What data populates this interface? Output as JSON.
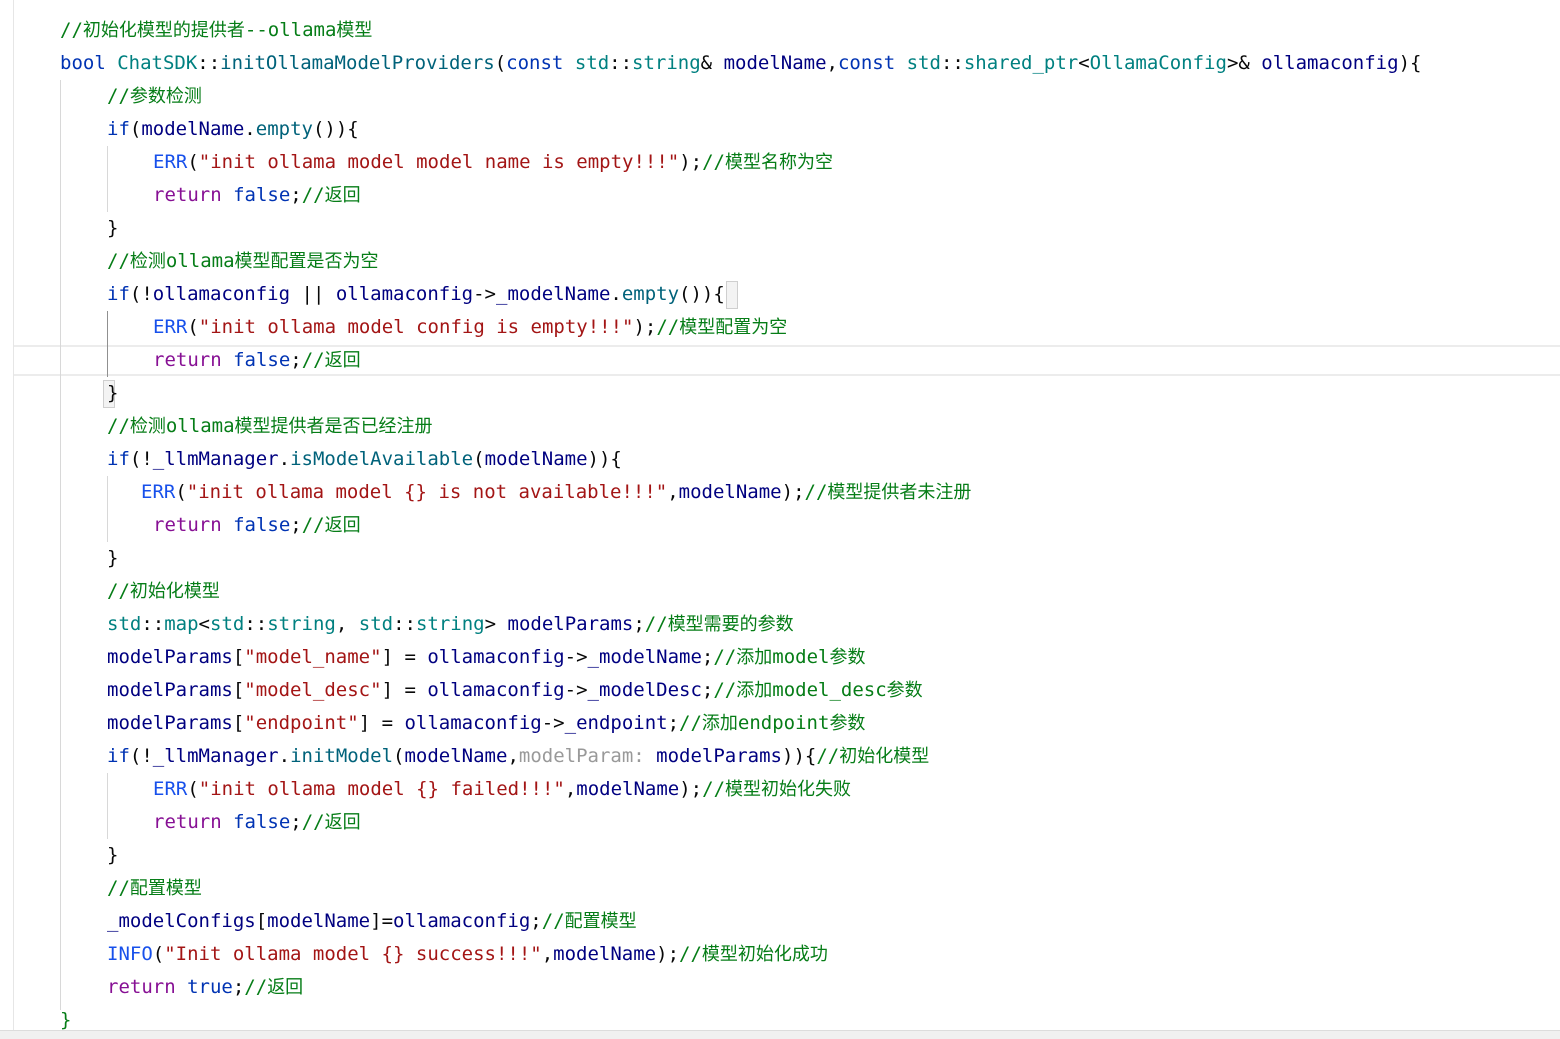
{
  "editor": {
    "lines": [
      {
        "indent": 0,
        "tokens": [
          {
            "t": "//初始化模型的提供者--ollama模型",
            "c": "c-cm-g"
          }
        ]
      },
      {
        "indent": 0,
        "tokens": [
          {
            "t": "bool ",
            "c": "c-kw"
          },
          {
            "t": "ChatSDK",
            "c": "c-ty"
          },
          {
            "t": "::",
            "c": "c-pl"
          },
          {
            "t": "initOllamaModelProviders",
            "c": "c-fn"
          },
          {
            "t": "(",
            "c": "c-pl"
          },
          {
            "t": "const ",
            "c": "c-kw"
          },
          {
            "t": "std",
            "c": "c-ty"
          },
          {
            "t": "::",
            "c": "c-pl"
          },
          {
            "t": "string",
            "c": "c-ty"
          },
          {
            "t": "& ",
            "c": "c-pl"
          },
          {
            "t": "modelName",
            "c": "c-id"
          },
          {
            "t": ",",
            "c": "c-pl"
          },
          {
            "t": "const ",
            "c": "c-kw"
          },
          {
            "t": "std",
            "c": "c-ty"
          },
          {
            "t": "::",
            "c": "c-pl"
          },
          {
            "t": "shared_ptr",
            "c": "c-ty"
          },
          {
            "t": "<",
            "c": "c-pl"
          },
          {
            "t": "OllamaConfig",
            "c": "c-ty"
          },
          {
            "t": ">& ",
            "c": "c-pl"
          },
          {
            "t": "ollamaconfig",
            "c": "c-id"
          },
          {
            "t": "){",
            "c": "c-pl"
          }
        ]
      },
      {
        "indent": 1,
        "tokens": [
          {
            "t": "//参数检测",
            "c": "c-cm-g"
          }
        ]
      },
      {
        "indent": 1,
        "tokens": [
          {
            "t": "if",
            "c": "c-kw"
          },
          {
            "t": "(",
            "c": "c-pl"
          },
          {
            "t": "modelName",
            "c": "c-id"
          },
          {
            "t": ".",
            "c": "c-pl"
          },
          {
            "t": "empty",
            "c": "c-fn"
          },
          {
            "t": "()){",
            "c": "c-pl"
          }
        ]
      },
      {
        "indent": 2,
        "tokens": [
          {
            "t": "ERR",
            "c": "c-mac"
          },
          {
            "t": "(",
            "c": "c-pl"
          },
          {
            "t": "\"init ollama model model name is empty!!!\"",
            "c": "c-str"
          },
          {
            "t": ");",
            "c": "c-pl"
          },
          {
            "t": "//模型名称为空",
            "c": "c-cm-g"
          }
        ]
      },
      {
        "indent": 2,
        "tokens": [
          {
            "t": "return ",
            "c": "c-kw2"
          },
          {
            "t": "false",
            "c": "c-kw"
          },
          {
            "t": ";",
            "c": "c-pl"
          },
          {
            "t": "//返回",
            "c": "c-cm-g"
          }
        ]
      },
      {
        "indent": 1,
        "tokens": [
          {
            "t": "}",
            "c": "c-pl"
          }
        ]
      },
      {
        "indent": 1,
        "tokens": [
          {
            "t": "//检测ollama模型配置是否为空",
            "c": "c-cm-g"
          }
        ]
      },
      {
        "indent": 1,
        "tokens": [
          {
            "t": "if",
            "c": "c-kw"
          },
          {
            "t": "(!",
            "c": "c-pl"
          },
          {
            "t": "ollamaconfig",
            "c": "c-id"
          },
          {
            "t": " || ",
            "c": "c-pl"
          },
          {
            "t": "ollamaconfig",
            "c": "c-id"
          },
          {
            "t": "->",
            "c": "c-pl"
          },
          {
            "t": "_modelName",
            "c": "c-id"
          },
          {
            "t": ".",
            "c": "c-pl"
          },
          {
            "t": "empty",
            "c": "c-fn"
          },
          {
            "t": "()){",
            "c": "c-pl"
          }
        ]
      },
      {
        "indent": 2,
        "tokens": [
          {
            "t": "ERR",
            "c": "c-mac"
          },
          {
            "t": "(",
            "c": "c-pl"
          },
          {
            "t": "\"init ollama model config is empty!!!\"",
            "c": "c-str"
          },
          {
            "t": ");",
            "c": "c-pl"
          },
          {
            "t": "//模型配置为空",
            "c": "c-cm-g"
          }
        ]
      },
      {
        "indent": 2,
        "tokens": [
          {
            "t": "return ",
            "c": "c-kw2"
          },
          {
            "t": "false",
            "c": "c-kw"
          },
          {
            "t": ";",
            "c": "c-pl"
          },
          {
            "t": "//返回",
            "c": "c-cm-g"
          }
        ]
      },
      {
        "indent": 1,
        "tokens": [
          {
            "t": "}",
            "c": "c-pl"
          }
        ]
      },
      {
        "indent": 1,
        "tokens": [
          {
            "t": "//检测ollama模型提供者是否已经注册",
            "c": "c-cm-g"
          }
        ]
      },
      {
        "indent": 1,
        "tokens": [
          {
            "t": "if",
            "c": "c-kw"
          },
          {
            "t": "(!",
            "c": "c-pl"
          },
          {
            "t": "_llmManager",
            "c": "c-id"
          },
          {
            "t": ".",
            "c": "c-pl"
          },
          {
            "t": "isModelAvailable",
            "c": "c-fn"
          },
          {
            "t": "(",
            "c": "c-pl"
          },
          {
            "t": "modelName",
            "c": "c-id"
          },
          {
            "t": ")){",
            "c": "c-pl"
          }
        ]
      },
      {
        "indent": 2,
        "shift": -12,
        "tokens": [
          {
            "t": "ERR",
            "c": "c-mac"
          },
          {
            "t": "(",
            "c": "c-pl"
          },
          {
            "t": "\"init ollama model {} is not available!!!\"",
            "c": "c-str"
          },
          {
            "t": ",",
            "c": "c-pl"
          },
          {
            "t": "modelName",
            "c": "c-id"
          },
          {
            "t": ");",
            "c": "c-pl"
          },
          {
            "t": "//模型提供者未注册",
            "c": "c-cm-g"
          }
        ]
      },
      {
        "indent": 2,
        "tokens": [
          {
            "t": "return ",
            "c": "c-kw2"
          },
          {
            "t": "false",
            "c": "c-kw"
          },
          {
            "t": ";",
            "c": "c-pl"
          },
          {
            "t": "//返回",
            "c": "c-cm-g"
          }
        ]
      },
      {
        "indent": 1,
        "tokens": [
          {
            "t": "}",
            "c": "c-pl"
          }
        ]
      },
      {
        "indent": 1,
        "tokens": [
          {
            "t": "//初始化模型",
            "c": "c-cm-g"
          }
        ]
      },
      {
        "indent": 1,
        "tokens": [
          {
            "t": "std",
            "c": "c-ty"
          },
          {
            "t": "::",
            "c": "c-pl"
          },
          {
            "t": "map",
            "c": "c-ty"
          },
          {
            "t": "<",
            "c": "c-pl"
          },
          {
            "t": "std",
            "c": "c-ty"
          },
          {
            "t": "::",
            "c": "c-pl"
          },
          {
            "t": "string",
            "c": "c-ty"
          },
          {
            "t": ", ",
            "c": "c-pl"
          },
          {
            "t": "std",
            "c": "c-ty"
          },
          {
            "t": "::",
            "c": "c-pl"
          },
          {
            "t": "string",
            "c": "c-ty"
          },
          {
            "t": "> ",
            "c": "c-pl"
          },
          {
            "t": "modelParams",
            "c": "c-id"
          },
          {
            "t": ";",
            "c": "c-pl"
          },
          {
            "t": "//模型需要的参数",
            "c": "c-cm-g"
          }
        ]
      },
      {
        "indent": 1,
        "tokens": [
          {
            "t": "modelParams",
            "c": "c-id"
          },
          {
            "t": "[",
            "c": "c-pl"
          },
          {
            "t": "\"model_name\"",
            "c": "c-str"
          },
          {
            "t": "] = ",
            "c": "c-pl"
          },
          {
            "t": "ollamaconfig",
            "c": "c-id"
          },
          {
            "t": "->",
            "c": "c-pl"
          },
          {
            "t": "_modelName",
            "c": "c-id"
          },
          {
            "t": ";",
            "c": "c-pl"
          },
          {
            "t": "//添加model参数",
            "c": "c-cm-g"
          }
        ]
      },
      {
        "indent": 1,
        "tokens": [
          {
            "t": "modelParams",
            "c": "c-id"
          },
          {
            "t": "[",
            "c": "c-pl"
          },
          {
            "t": "\"model_desc\"",
            "c": "c-str"
          },
          {
            "t": "] = ",
            "c": "c-pl"
          },
          {
            "t": "ollamaconfig",
            "c": "c-id"
          },
          {
            "t": "->",
            "c": "c-pl"
          },
          {
            "t": "_modelDesc",
            "c": "c-id"
          },
          {
            "t": ";",
            "c": "c-pl"
          },
          {
            "t": "//添加model_desc参数",
            "c": "c-cm-g"
          }
        ]
      },
      {
        "indent": 1,
        "tokens": [
          {
            "t": "modelParams",
            "c": "c-id"
          },
          {
            "t": "[",
            "c": "c-pl"
          },
          {
            "t": "\"endpoint\"",
            "c": "c-str"
          },
          {
            "t": "] = ",
            "c": "c-pl"
          },
          {
            "t": "ollamaconfig",
            "c": "c-id"
          },
          {
            "t": "->",
            "c": "c-pl"
          },
          {
            "t": "_endpoint",
            "c": "c-id"
          },
          {
            "t": ";",
            "c": "c-pl"
          },
          {
            "t": "//添加endpoint参数",
            "c": "c-cm-g"
          }
        ]
      },
      {
        "indent": 1,
        "tokens": [
          {
            "t": "if",
            "c": "c-kw"
          },
          {
            "t": "(!",
            "c": "c-pl"
          },
          {
            "t": "_llmManager",
            "c": "c-id"
          },
          {
            "t": ".",
            "c": "c-pl"
          },
          {
            "t": "initModel",
            "c": "c-fn"
          },
          {
            "t": "(",
            "c": "c-pl"
          },
          {
            "t": "modelName",
            "c": "c-id"
          },
          {
            "t": ",",
            "c": "c-pl"
          },
          {
            "t": "modelParam: ",
            "c": "c-hint"
          },
          {
            "t": "modelParams",
            "c": "c-id"
          },
          {
            "t": ")){",
            "c": "c-pl"
          },
          {
            "t": "//初始化模型",
            "c": "c-cm-g"
          }
        ]
      },
      {
        "indent": 2,
        "tokens": [
          {
            "t": "ERR",
            "c": "c-mac"
          },
          {
            "t": "(",
            "c": "c-pl"
          },
          {
            "t": "\"init ollama model {} failed!!!\"",
            "c": "c-str"
          },
          {
            "t": ",",
            "c": "c-pl"
          },
          {
            "t": "modelName",
            "c": "c-id"
          },
          {
            "t": ");",
            "c": "c-pl"
          },
          {
            "t": "//模型初始化失败",
            "c": "c-cm-g"
          }
        ]
      },
      {
        "indent": 2,
        "tokens": [
          {
            "t": "return ",
            "c": "c-kw2"
          },
          {
            "t": "false",
            "c": "c-kw"
          },
          {
            "t": ";",
            "c": "c-pl"
          },
          {
            "t": "//返回",
            "c": "c-cm-g"
          }
        ]
      },
      {
        "indent": 1,
        "tokens": [
          {
            "t": "}",
            "c": "c-pl"
          }
        ]
      },
      {
        "indent": 1,
        "tokens": [
          {
            "t": "//配置模型",
            "c": "c-cm-g"
          }
        ]
      },
      {
        "indent": 1,
        "tokens": [
          {
            "t": "_modelConfigs",
            "c": "c-id"
          },
          {
            "t": "[",
            "c": "c-pl"
          },
          {
            "t": "modelName",
            "c": "c-id"
          },
          {
            "t": "]=",
            "c": "c-pl"
          },
          {
            "t": "ollamaconfig",
            "c": "c-id"
          },
          {
            "t": ";",
            "c": "c-pl"
          },
          {
            "t": "//配置模型",
            "c": "c-cm-g"
          }
        ]
      },
      {
        "indent": 1,
        "tokens": [
          {
            "t": "INFO",
            "c": "c-mac"
          },
          {
            "t": "(",
            "c": "c-pl"
          },
          {
            "t": "\"Init ollama model {} success!!!\"",
            "c": "c-str"
          },
          {
            "t": ",",
            "c": "c-pl"
          },
          {
            "t": "modelName",
            "c": "c-id"
          },
          {
            "t": ");",
            "c": "c-pl"
          },
          {
            "t": "//模型初始化成功",
            "c": "c-cm-g"
          }
        ]
      },
      {
        "indent": 1,
        "tokens": [
          {
            "t": "return ",
            "c": "c-kw2"
          },
          {
            "t": "true",
            "c": "c-kw"
          },
          {
            "t": ";",
            "c": "c-pl"
          },
          {
            "t": "//返回",
            "c": "c-cm-g"
          }
        ]
      },
      {
        "indent": 0,
        "tokens": [
          {
            "t": "}",
            "c": "c-cm-g"
          }
        ]
      }
    ]
  },
  "colors": {
    "background": "#ffffff",
    "keyword": "#0033b3",
    "return_keyword": "#871094",
    "type": "#008080",
    "function": "#00627a",
    "string": "#a31515",
    "identifier": "#000080",
    "macro": "#1750eb",
    "comment": "#067d17",
    "param_hint": "#999999"
  }
}
